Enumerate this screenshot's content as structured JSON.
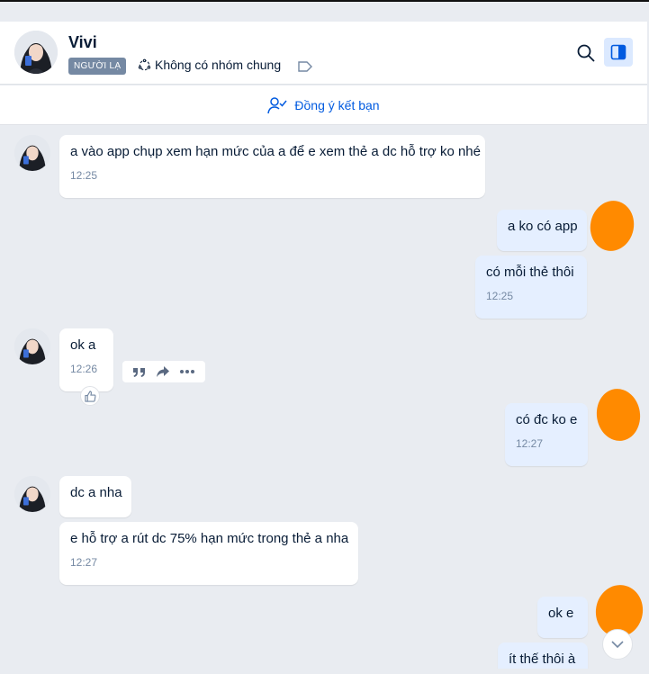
{
  "header": {
    "name": "Vivi",
    "badge": "NGƯỜI LẠ",
    "common_groups": "Không có nhóm chung"
  },
  "friend_bar": {
    "label": "Đồng ý kết bạn"
  },
  "messages": [
    {
      "text": "a vào app chụp xem hạn mức của a để e xem thẻ a dc hỗ trợ ko nhé",
      "time": "12:25",
      "side": "received"
    },
    {
      "text": "a ko có app",
      "side": "sent"
    },
    {
      "text": "có mỗi thẻ thôi",
      "time": "12:25",
      "side": "sent"
    },
    {
      "text": "ok a",
      "time": "12:26",
      "side": "received"
    },
    {
      "text": "có đc ko e",
      "time": "12:27",
      "side": "sent"
    },
    {
      "text": "dc a nha",
      "side": "received"
    },
    {
      "text": "e hỗ trợ a rút dc 75% hạn mức trong thẻ a nha",
      "time": "12:27",
      "side": "received"
    },
    {
      "text": "ok e",
      "side": "sent"
    },
    {
      "text": "ít thế thôi à",
      "side": "sent"
    }
  ],
  "icons": {
    "search": "search-icon",
    "panel": "sidebar-toggle-icon",
    "quote": "quote-icon",
    "forward": "forward-icon",
    "more": "more-icon",
    "like": "thumbs-up-icon"
  },
  "colors": {
    "accent": "#005ae0",
    "sent_bubble": "#e5efff",
    "received_bubble": "#ffffff",
    "background": "#e9ecf1",
    "redaction": "#ff8a00"
  }
}
